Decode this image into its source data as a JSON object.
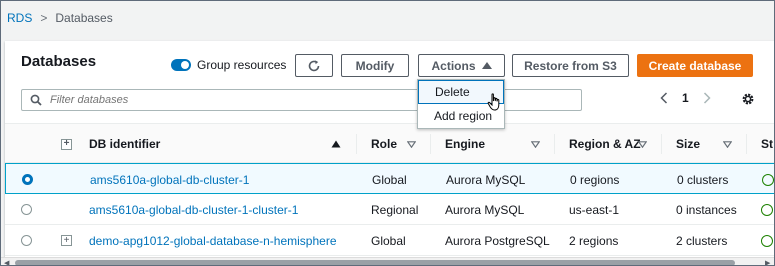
{
  "breadcrumb": {
    "root": "RDS",
    "separator": ">",
    "current": "Databases"
  },
  "panel": {
    "title": "Databases",
    "group_resources_label": "Group resources",
    "group_resources_on": true
  },
  "toolbar": {
    "modify_label": "Modify",
    "actions_label": "Actions",
    "restore_label": "Restore from S3",
    "create_label": "Create database"
  },
  "search": {
    "placeholder": "Filter databases",
    "value": ""
  },
  "pagination": {
    "current_page": "1"
  },
  "actions_menu": {
    "items": [
      "Delete",
      "Add region"
    ],
    "hovered": "Delete"
  },
  "table": {
    "columns": [
      "DB identifier",
      "Role",
      "Engine",
      "Region & AZ",
      "Size",
      "St"
    ],
    "rows": [
      {
        "identifier": "ams5610a-global-db-cluster-1",
        "role": "Global",
        "engine": "Aurora MySQL",
        "region": "0 regions",
        "size": "0 clusters",
        "selected": true,
        "expandable": false
      },
      {
        "identifier": "ams5610a-global-db-cluster-1-cluster-1",
        "role": "Regional",
        "engine": "Aurora MySQL",
        "region": "us-east-1",
        "size": "0 instances",
        "selected": false,
        "expandable": false
      },
      {
        "identifier": "demo-apg1012-global-database-n-hemisphere",
        "role": "Global",
        "engine": "Aurora PostgreSQL",
        "region": "2 regions",
        "size": "2 clusters",
        "selected": false,
        "expandable": true
      }
    ]
  },
  "colors": {
    "accent": "#0073bb",
    "primary_button": "#ec7211",
    "status_ok": "#1d8102"
  }
}
